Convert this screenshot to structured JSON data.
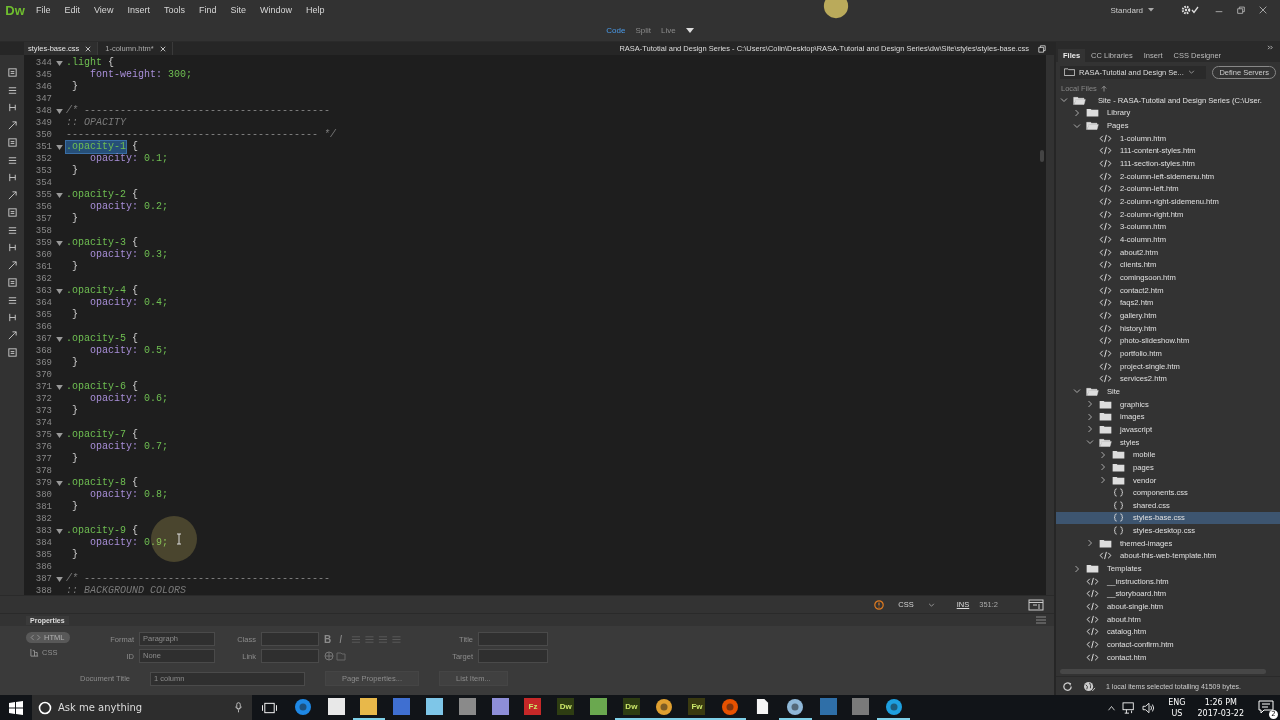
{
  "app": {
    "logo": "Dw",
    "menus": [
      "File",
      "Edit",
      "View",
      "Insert",
      "Tools",
      "Find",
      "Site",
      "Window",
      "Help"
    ],
    "workspace": "Standard"
  },
  "views": [
    {
      "label": "Code",
      "selected": true
    },
    {
      "label": "Split",
      "selected": false
    },
    {
      "label": "Live",
      "selected": false
    }
  ],
  "documents": [
    {
      "label": "styles-base.css",
      "selected": true
    },
    {
      "label": "1-column.htm*",
      "selected": false
    }
  ],
  "path": "RASA-Tutotial and Design Series - C:\\Users\\Colin\\Desktop\\RASA-Tutorial and Design Series\\dw\\Site\\styles\\styles-base.css",
  "code": [
    {
      "n": "344",
      "kind": "selector",
      "selector": ".light",
      "brace": "{",
      "highlighted": false
    },
    {
      "n": "345",
      "kind": "property",
      "prop": "font-weight:",
      "value": "300;"
    },
    {
      "n": "346",
      "kind": "close",
      "text": "}"
    },
    {
      "n": "347",
      "kind": "blank"
    },
    {
      "n": "348",
      "kind": "comment_open",
      "text": "/* -----------------------------------------"
    },
    {
      "n": "349",
      "kind": "comment",
      "text": ":: OPACITY"
    },
    {
      "n": "350",
      "kind": "comment",
      "text": "------------------------------------------ */"
    },
    {
      "n": "351",
      "kind": "selector",
      "selector": ".opacity-1",
      "brace": "{",
      "highlighted": true
    },
    {
      "n": "352",
      "kind": "property",
      "prop": "opacity:",
      "value": "0.1;"
    },
    {
      "n": "353",
      "kind": "close",
      "text": "}"
    },
    {
      "n": "354",
      "kind": "blank"
    },
    {
      "n": "355",
      "kind": "selector",
      "selector": ".opacity-2",
      "brace": "{",
      "highlighted": false
    },
    {
      "n": "356",
      "kind": "property",
      "prop": "opacity:",
      "value": "0.2;"
    },
    {
      "n": "357",
      "kind": "close",
      "text": "}"
    },
    {
      "n": "358",
      "kind": "blank"
    },
    {
      "n": "359",
      "kind": "selector",
      "selector": ".opacity-3",
      "brace": "{",
      "highlighted": false
    },
    {
      "n": "360",
      "kind": "property",
      "prop": "opacity:",
      "value": "0.3;"
    },
    {
      "n": "361",
      "kind": "close",
      "text": "}"
    },
    {
      "n": "362",
      "kind": "blank"
    },
    {
      "n": "363",
      "kind": "selector",
      "selector": ".opacity-4",
      "brace": "{",
      "highlighted": false
    },
    {
      "n": "364",
      "kind": "property",
      "prop": "opacity:",
      "value": "0.4;"
    },
    {
      "n": "365",
      "kind": "close",
      "text": "}"
    },
    {
      "n": "366",
      "kind": "blank"
    },
    {
      "n": "367",
      "kind": "selector",
      "selector": ".opacity-5",
      "brace": "{",
      "highlighted": false
    },
    {
      "n": "368",
      "kind": "property",
      "prop": "opacity:",
      "value": "0.5;"
    },
    {
      "n": "369",
      "kind": "close",
      "text": "}"
    },
    {
      "n": "370",
      "kind": "blank"
    },
    {
      "n": "371",
      "kind": "selector",
      "selector": ".opacity-6",
      "brace": "{",
      "highlighted": false
    },
    {
      "n": "372",
      "kind": "property",
      "prop": "opacity:",
      "value": "0.6;"
    },
    {
      "n": "373",
      "kind": "close",
      "text": "}"
    },
    {
      "n": "374",
      "kind": "blank"
    },
    {
      "n": "375",
      "kind": "selector",
      "selector": ".opacity-7",
      "brace": "{",
      "highlighted": false
    },
    {
      "n": "376",
      "kind": "property",
      "prop": "opacity:",
      "value": "0.7;"
    },
    {
      "n": "377",
      "kind": "close",
      "text": "}"
    },
    {
      "n": "378",
      "kind": "blank"
    },
    {
      "n": "379",
      "kind": "selector",
      "selector": ".opacity-8",
      "brace": "{",
      "highlighted": false
    },
    {
      "n": "380",
      "kind": "property",
      "prop": "opacity:",
      "value": "0.8;"
    },
    {
      "n": "381",
      "kind": "close",
      "text": "}"
    },
    {
      "n": "382",
      "kind": "blank"
    },
    {
      "n": "383",
      "kind": "selector",
      "selector": ".opacity-9",
      "brace": "{",
      "highlighted": false
    },
    {
      "n": "384",
      "kind": "property",
      "prop": "opacity:",
      "value": "0.9;"
    },
    {
      "n": "385",
      "kind": "close",
      "text": "}"
    },
    {
      "n": "386",
      "kind": "blank"
    },
    {
      "n": "387",
      "kind": "comment_open",
      "text": "/* -----------------------------------------"
    },
    {
      "n": "388",
      "kind": "comment",
      "text": ":: BACKGROUND COLORS"
    }
  ],
  "status": {
    "language": "CSS",
    "mode": "INS",
    "position": "351:2"
  },
  "properties": {
    "title": "Properties",
    "disabled": true,
    "toggles": [
      {
        "label": "HTML",
        "selected": true
      },
      {
        "label": "CSS",
        "selected": false
      }
    ],
    "format_label": "Format",
    "format_value": "Paragraph",
    "id_label": "ID",
    "id_value": "None",
    "class_label": "Class",
    "link_label": "Link",
    "title_label": "Title",
    "format_buttons": [
      "B",
      "I"
    ],
    "target_label": "Target",
    "doc_title_label": "Document Title",
    "doc_title_value": "1 column",
    "buttons": [
      "Page Properties...",
      "List Item..."
    ]
  },
  "panel": {
    "tabs": [
      {
        "label": "Files",
        "selected": true
      },
      {
        "label": "CC Libraries",
        "selected": false
      },
      {
        "label": "Insert",
        "selected": false
      },
      {
        "label": "CSS Designer",
        "selected": false
      }
    ],
    "site": "RASA-Tutotial and Design Se...",
    "define_button": "Define Servers",
    "local_files": "Local Files",
    "tree": [
      {
        "label": "Site - RASA-Tutotial and Design Series (C:\\User.",
        "kind": "site",
        "expanded": true,
        "selected": false,
        "children": [
          {
            "label": "Library",
            "kind": "folder",
            "expanded": false,
            "selected": false
          },
          {
            "label": "Pages",
            "kind": "folder",
            "expanded": true,
            "selected": false,
            "children": [
              {
                "label": "1-column.htm",
                "kind": "html",
                "selected": false
              },
              {
                "label": "111-content-styles.htm",
                "kind": "html",
                "selected": false
              },
              {
                "label": "111-section-styles.htm",
                "kind": "html",
                "selected": false
              },
              {
                "label": "2-column-left-sidemenu.htm",
                "kind": "html",
                "selected": false
              },
              {
                "label": "2-column-left.htm",
                "kind": "html",
                "selected": false
              },
              {
                "label": "2-column-right-sidemenu.htm",
                "kind": "html",
                "selected": false
              },
              {
                "label": "2-column-right.htm",
                "kind": "html",
                "selected": false
              },
              {
                "label": "3-column.htm",
                "kind": "html",
                "selected": false
              },
              {
                "label": "4-column.htm",
                "kind": "html",
                "selected": false
              },
              {
                "label": "about2.htm",
                "kind": "html",
                "selected": false
              },
              {
                "label": "clients.htm",
                "kind": "html",
                "selected": false
              },
              {
                "label": "comingsoon.htm",
                "kind": "html",
                "selected": false
              },
              {
                "label": "contact2.htm",
                "kind": "html",
                "selected": false
              },
              {
                "label": "faqs2.htm",
                "kind": "html",
                "selected": false
              },
              {
                "label": "gallery.htm",
                "kind": "html",
                "selected": false
              },
              {
                "label": "history.htm",
                "kind": "html",
                "selected": false
              },
              {
                "label": "photo-slideshow.htm",
                "kind": "html",
                "selected": false
              },
              {
                "label": "portfolio.htm",
                "kind": "html",
                "selected": false
              },
              {
                "label": "project-single.htm",
                "kind": "html",
                "selected": false
              },
              {
                "label": "services2.htm",
                "kind": "html",
                "selected": false
              }
            ]
          },
          {
            "label": "Site",
            "kind": "folder",
            "expanded": true,
            "selected": false,
            "children": [
              {
                "label": "graphics",
                "kind": "folder",
                "expanded": false,
                "selected": false
              },
              {
                "label": "images",
                "kind": "folder",
                "expanded": false,
                "selected": false
              },
              {
                "label": "javascript",
                "kind": "folder",
                "expanded": false,
                "selected": false
              },
              {
                "label": "styles",
                "kind": "folder",
                "expanded": true,
                "selected": false,
                "children": [
                  {
                    "label": "mobile",
                    "kind": "folder",
                    "expanded": false,
                    "selected": false
                  },
                  {
                    "label": "pages",
                    "kind": "folder",
                    "expanded": false,
                    "selected": false
                  },
                  {
                    "label": "vendor",
                    "kind": "folder",
                    "expanded": false,
                    "selected": false
                  },
                  {
                    "label": "components.css",
                    "kind": "css",
                    "selected": false
                  },
                  {
                    "label": "shared.css",
                    "kind": "css",
                    "selected": false
                  },
                  {
                    "label": "styles-base.css",
                    "kind": "css",
                    "selected": true
                  },
                  {
                    "label": "styles-desktop.css",
                    "kind": "css",
                    "selected": false
                  }
                ]
              },
              {
                "label": "themed-images",
                "kind": "folder",
                "expanded": false,
                "selected": false
              },
              {
                "label": "about-this-web-template.htm",
                "kind": "html",
                "selected": false
              }
            ]
          },
          {
            "label": "Templates",
            "kind": "folder",
            "expanded": false,
            "selected": false
          },
          {
            "label": "__instructions.htm",
            "kind": "html",
            "selected": false
          },
          {
            "label": "__storyboard.htm",
            "kind": "html",
            "selected": false
          },
          {
            "label": "about-single.htm",
            "kind": "html",
            "selected": false
          },
          {
            "label": "about.htm",
            "kind": "html",
            "selected": false
          },
          {
            "label": "catalog.htm",
            "kind": "html",
            "selected": false
          },
          {
            "label": "contact-confirm.htm",
            "kind": "html",
            "selected": false
          },
          {
            "label": "contact.htm",
            "kind": "html",
            "selected": false
          }
        ]
      }
    ],
    "footer": "1 local items selected totalling 41509 bytes."
  },
  "taskbar": {
    "search": "Ask me anything",
    "apps": [
      {
        "kind": "circle",
        "color": "#1e88e5",
        "open": false
      },
      {
        "kind": "tile",
        "color": "#e8e8e8",
        "open": false
      },
      {
        "kind": "tile",
        "color": "#e8b84a",
        "open": true
      },
      {
        "kind": "tile",
        "color": "#3f6fd1",
        "open": false
      },
      {
        "kind": "tile",
        "color": "#7ec6e8",
        "open": false
      },
      {
        "kind": "tile",
        "color": "#8a8a8a",
        "open": false
      },
      {
        "kind": "tile",
        "color": "#8e8ed8",
        "open": false
      },
      {
        "kind": "tile",
        "color": "#c62828",
        "label": "Fz",
        "open": false
      },
      {
        "kind": "tile",
        "color": "#2e3d12",
        "label": "Dw",
        "open": false
      },
      {
        "kind": "tile",
        "color": "#6aa84f",
        "open": false
      },
      {
        "kind": "tile",
        "color": "#2e3d12",
        "label": "Dw",
        "open": true
      },
      {
        "kind": "circle",
        "color": "#e0a030",
        "open": true
      },
      {
        "kind": "tile",
        "color": "#3a3a10",
        "label": "Fw",
        "open": true
      },
      {
        "kind": "circle",
        "color": "#e65100",
        "open": true
      },
      {
        "kind": "page",
        "color": "#f5f5f5",
        "open": false
      },
      {
        "kind": "circle",
        "color": "#8fb8d8",
        "open": true
      },
      {
        "kind": "tile",
        "color": "#2f6fa8",
        "open": false
      },
      {
        "kind": "tile",
        "color": "#7a7a7a",
        "open": false
      },
      {
        "kind": "circle",
        "color": "#1ea0e0",
        "open": true
      }
    ],
    "lang": "ENG",
    "region": "US",
    "time": "1:26 PM",
    "date": "2017-03-22",
    "notifications": "2"
  }
}
